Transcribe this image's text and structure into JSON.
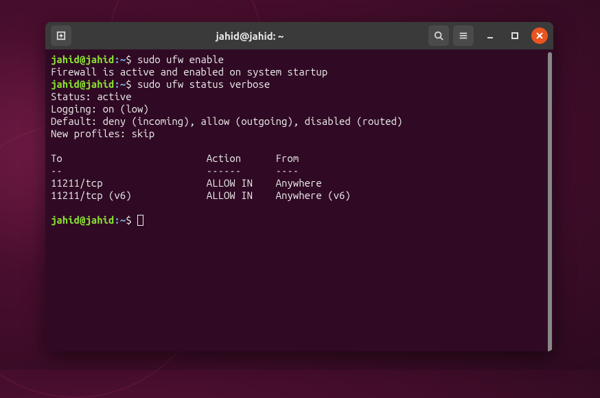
{
  "window": {
    "title": "jahid@jahid: ~"
  },
  "prompt": {
    "user": "jahid@jahid",
    "sep": ":",
    "path": "~",
    "sym": "$"
  },
  "lines": {
    "cmd1": "sudo ufw enable",
    "out1": "Firewall is active and enabled on system startup",
    "cmd2": "sudo ufw status verbose",
    "out2": "Status: active",
    "out3": "Logging: on (low)",
    "out4": "Default: deny (incoming), allow (outgoing), disabled (routed)",
    "out5": "New profiles: skip",
    "blank": "",
    "hdr": "To                         Action      From",
    "sep": "--                         ------      ----",
    "row1": "11211/tcp                  ALLOW IN    Anywhere",
    "row2": "11211/tcp (v6)             ALLOW IN    Anywhere (v6)"
  }
}
